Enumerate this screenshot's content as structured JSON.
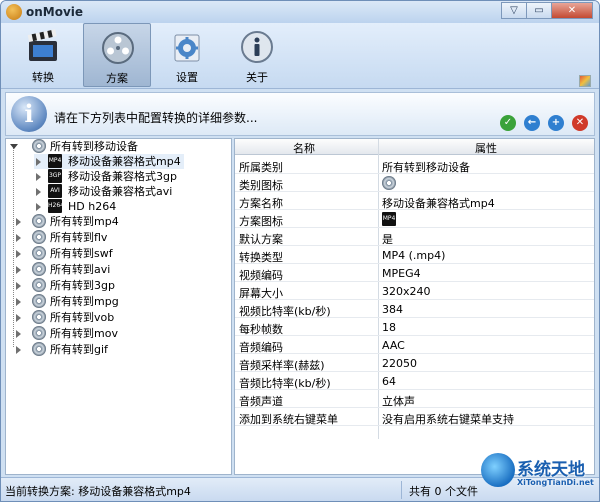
{
  "window": {
    "title": "onMovie",
    "min": "▽",
    "max": "▭",
    "close": "✕"
  },
  "toolbar": {
    "items": [
      {
        "label": "转换",
        "icon": "film-clapper-icon"
      },
      {
        "label": "方案",
        "icon": "film-reel-icon"
      },
      {
        "label": "设置",
        "icon": "gear-settings-icon"
      },
      {
        "label": "关于",
        "icon": "info-globe-icon"
      }
    ],
    "active": "方案"
  },
  "infobar": {
    "icon_glyph": "i",
    "text": "请在下方列表中配置转换的详细参数...",
    "actions": [
      {
        "name": "confirm-icon",
        "glyph": "✓",
        "color": "#3aa23a"
      },
      {
        "name": "back-icon",
        "glyph": "←",
        "color": "#2f7fd0"
      },
      {
        "name": "add-icon",
        "glyph": "+",
        "color": "#2f7fd0"
      },
      {
        "name": "delete-icon",
        "glyph": "✕",
        "color": "#d03a2a"
      }
    ]
  },
  "tree": {
    "root": "所有转到移动设备",
    "children": [
      "移动设备兼容格式mp4",
      "移动设备兼容格式3gp",
      "移动设备兼容格式avi",
      "HD h264"
    ],
    "groups": [
      "所有转到mp4",
      "所有转到flv",
      "所有转到swf",
      "所有转到avi",
      "所有转到3gp",
      "所有转到mpg",
      "所有转到vob",
      "所有转到mov",
      "所有转到gif"
    ]
  },
  "grid": {
    "col_name": "名称",
    "col_value": "属性",
    "rows": [
      {
        "k": "所属类别",
        "v": "所有转到移动设备"
      },
      {
        "k": "类别图标",
        "v": ""
      },
      {
        "k": "方案名称",
        "v": "移动设备兼容格式mp4"
      },
      {
        "k": "方案图标",
        "v": ""
      },
      {
        "k": "默认方案",
        "v": "是"
      },
      {
        "k": "转换类型",
        "v": "MP4 (.mp4)"
      },
      {
        "k": "视频编码",
        "v": "MPEG4"
      },
      {
        "k": "屏幕大小",
        "v": "320x240"
      },
      {
        "k": "视频比特率(kb/秒)",
        "v": "384"
      },
      {
        "k": "每秒帧数",
        "v": "18"
      },
      {
        "k": "音频编码",
        "v": "AAC"
      },
      {
        "k": "音频采样率(赫兹)",
        "v": "22050"
      },
      {
        "k": "音频比特率(kb/秒)",
        "v": "64"
      },
      {
        "k": "音频声道",
        "v": "立体声"
      },
      {
        "k": "添加到系统右键菜单",
        "v": "没有启用系统右键菜单支持"
      }
    ]
  },
  "status": {
    "current": "当前转换方案: 移动设备兼容格式mp4",
    "count": "共有 0 个文件"
  },
  "watermark": {
    "cn": "系统天地",
    "en": "XiTongTianDi.net"
  }
}
